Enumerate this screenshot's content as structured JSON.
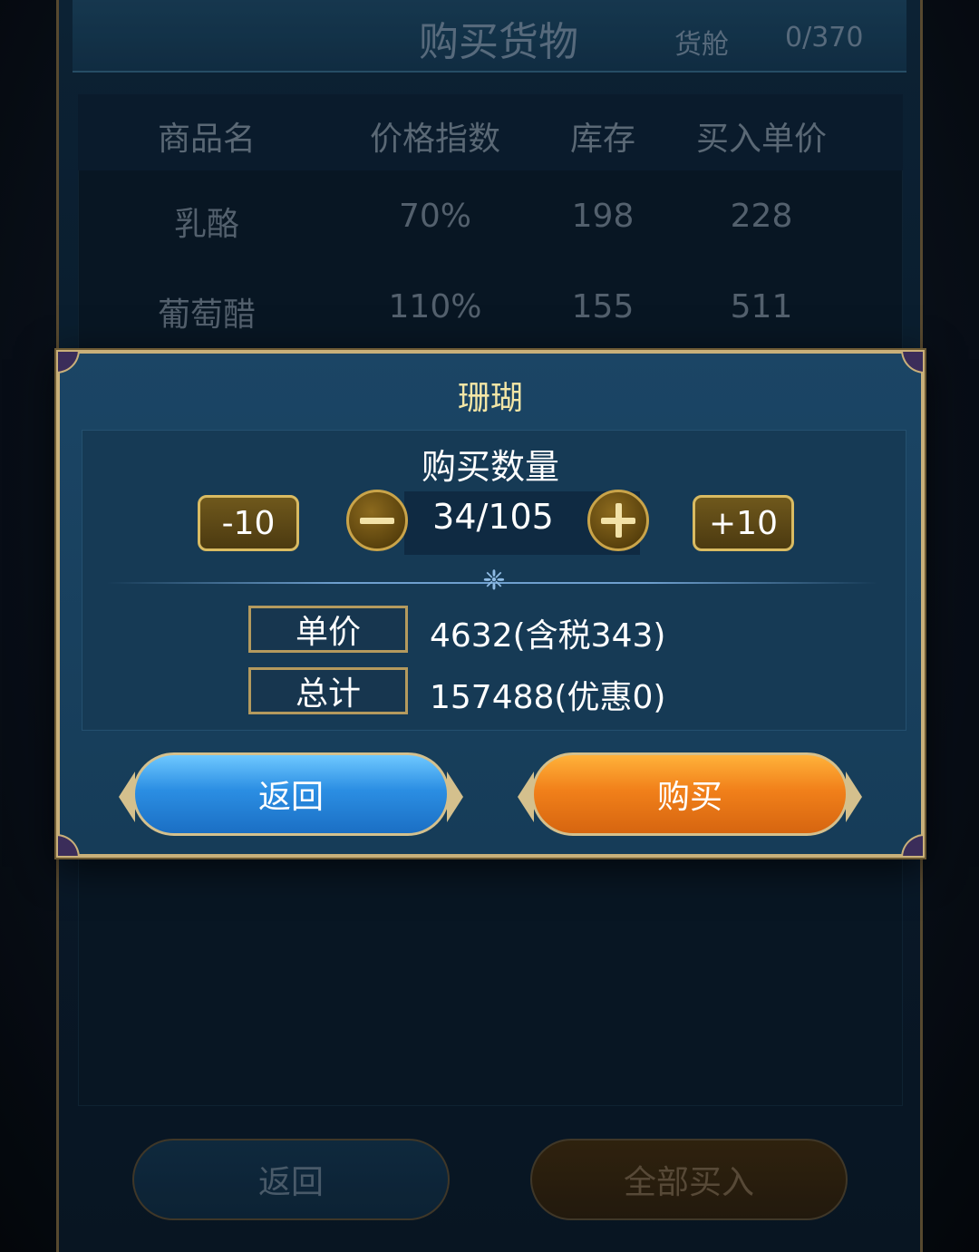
{
  "background": {
    "title": "购买货物",
    "hold_label": "货舱",
    "hold_value": "0/370",
    "table": {
      "headers": [
        "商品名",
        "价格指数",
        "库存",
        "买入单价"
      ],
      "rows": [
        [
          "乳酪",
          "70%",
          "198",
          "228"
        ],
        [
          "葡萄醋",
          "110%",
          "155",
          "511"
        ]
      ]
    },
    "buttons": {
      "back": "返回",
      "buy_all": "全部买入"
    }
  },
  "dialog": {
    "item_name": "珊瑚",
    "quantity_label": "购买数量",
    "minus10_label": "-10",
    "plus10_label": "+10",
    "quantity_value": "34/105",
    "unit_price_label": "单价",
    "unit_price_value": "4632(含税343)",
    "total_label": "总计",
    "total_value": "157488(优惠0)",
    "back_label": "返回",
    "buy_label": "购买"
  },
  "colors": {
    "dialog_border": "#c9b07a",
    "title_color": "#f3e6a6",
    "blue_button": "#2b8ee3",
    "orange_button": "#f1801a"
  }
}
